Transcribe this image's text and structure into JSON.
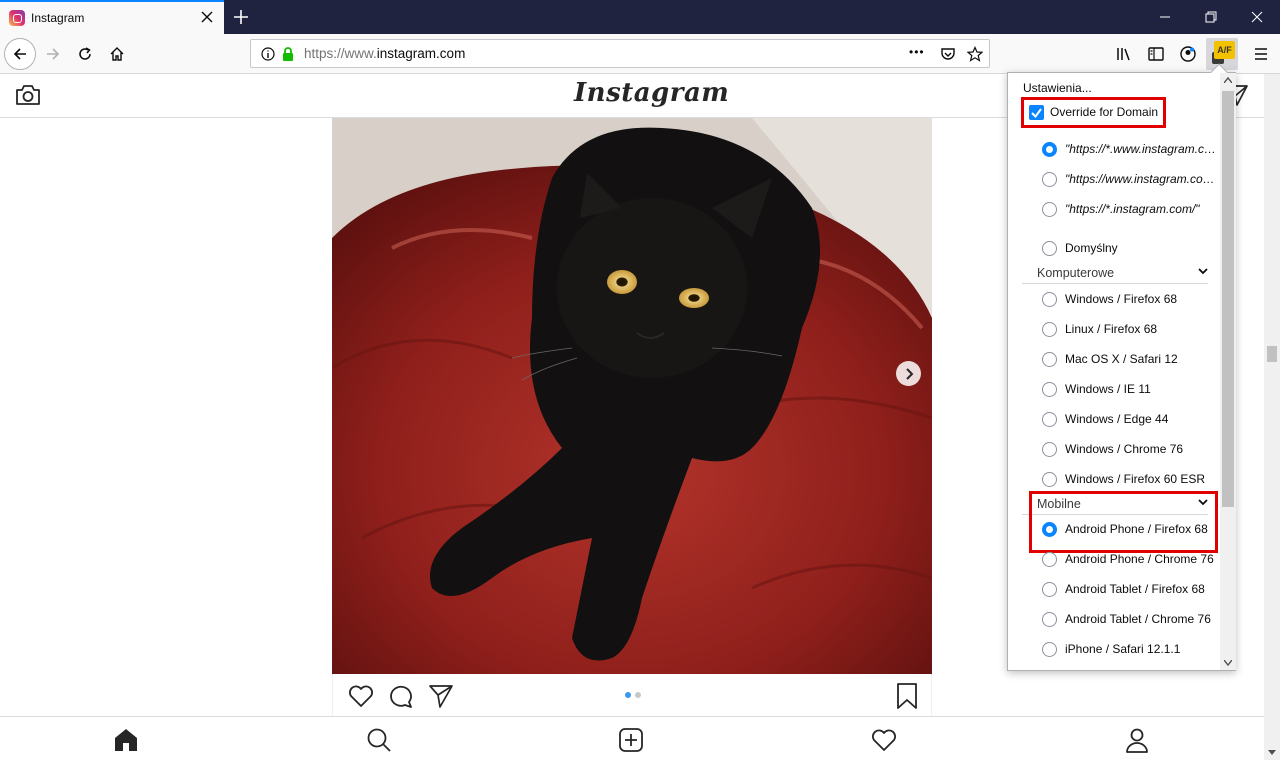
{
  "browser": {
    "tab_title": "Instagram",
    "url_prefix": "https://www.",
    "url_host": "instagram.com",
    "url_more": "•••"
  },
  "instagram": {
    "logo": "Instagram",
    "carousel_index": 1,
    "carousel_count": 2
  },
  "popup": {
    "settings_label": "Ustawienia...",
    "override_label": "Override for Domain",
    "override_checked": true,
    "domain_options": [
      {
        "label": "\"https://*.www.instagram.com/\"",
        "selected": true
      },
      {
        "label": "\"https://www.instagram.com/\"",
        "selected": false
      },
      {
        "label": "\"https://*.instagram.com/\"",
        "selected": false
      }
    ],
    "default_label": "Domyślny",
    "desktop_section": "Komputerowe",
    "desktop_options": [
      {
        "label": "Windows / Firefox 68",
        "selected": false
      },
      {
        "label": "Linux / Firefox 68",
        "selected": false
      },
      {
        "label": "Mac OS X / Safari 12",
        "selected": false
      },
      {
        "label": "Windows / IE 11",
        "selected": false
      },
      {
        "label": "Windows / Edge 44",
        "selected": false
      },
      {
        "label": "Windows / Chrome 76",
        "selected": false
      },
      {
        "label": "Windows / Firefox 60 ESR",
        "selected": false
      }
    ],
    "mobile_section": "Mobilne",
    "mobile_options": [
      {
        "label": "Android Phone / Firefox 68",
        "selected": true
      },
      {
        "label": "Android Phone / Chrome 76",
        "selected": false
      },
      {
        "label": "Android Tablet / Firefox 68",
        "selected": false
      },
      {
        "label": "Android Tablet / Chrome 76",
        "selected": false
      },
      {
        "label": "iPhone / Safari 12.1.1",
        "selected": false
      }
    ],
    "badge": "A/F"
  },
  "colors": {
    "accent": "#0a84ff",
    "highlight": "#e00000",
    "tabbar": "#202340"
  }
}
